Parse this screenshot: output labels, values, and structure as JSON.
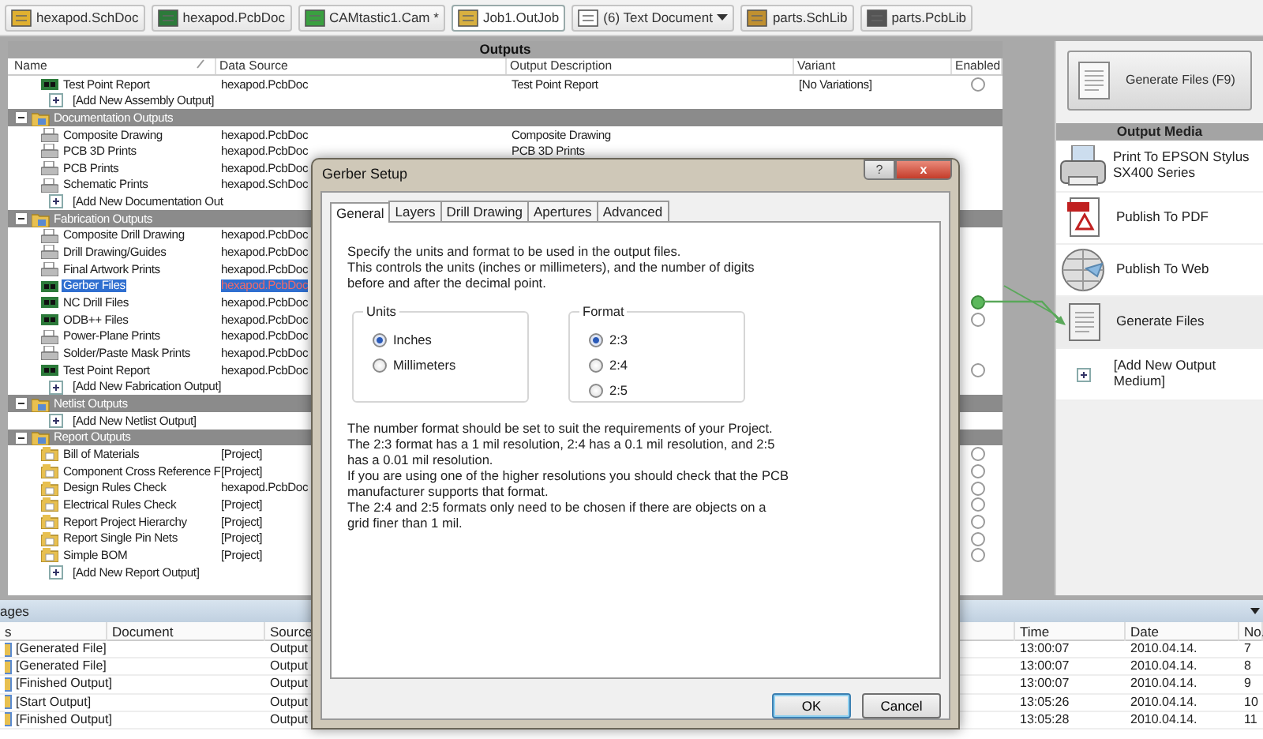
{
  "doc_tabs": [
    {
      "label": "hexapod.SchDoc",
      "kind": "schdoc",
      "selected": false
    },
    {
      "label": "hexapod.PcbDoc",
      "kind": "pcbdoc",
      "selected": false
    },
    {
      "label": "CAMtastic1.Cam *",
      "kind": "cam",
      "selected": false
    },
    {
      "label": "Job1.OutJob",
      "kind": "outjob",
      "selected": true
    },
    {
      "label": "(6) Text Document",
      "kind": "text",
      "selected": false,
      "dropdown": true
    },
    {
      "label": "parts.SchLib",
      "kind": "schlib",
      "selected": false
    },
    {
      "label": "parts.PcbLib",
      "kind": "pcblib",
      "selected": false
    }
  ],
  "outputs": {
    "title": "Outputs",
    "columns": [
      "Name",
      "Data Source",
      "Output Description",
      "Variant",
      "Enabled"
    ],
    "rows": [
      {
        "kind": "pcb",
        "name": "Test Point Report",
        "source": "hexapod.PcbDoc",
        "description": "Test Point Report",
        "variant": "[No Variations]",
        "enabled": false,
        "selected": false
      },
      {
        "kind": "add",
        "name": "[Add New Assembly Output]",
        "selected": false
      },
      {
        "kind": "group",
        "name": "Documentation Outputs",
        "expanded": true,
        "children": [
          {
            "kind": "print",
            "name": "Composite Drawing",
            "source": "hexapod.PcbDoc",
            "description": "Composite Drawing",
            "selected": false
          },
          {
            "kind": "print",
            "name": "PCB 3D Prints",
            "source": "hexapod.PcbDoc",
            "description": "PCB 3D Prints",
            "selected": false
          },
          {
            "kind": "print",
            "name": "PCB Prints",
            "source": "hexapod.PcbDoc",
            "selected": false
          },
          {
            "kind": "print",
            "name": "Schematic Prints",
            "source": "hexapod.SchDoc",
            "selected": false
          },
          {
            "kind": "add",
            "name": "[Add New Documentation Out",
            "selected": false
          }
        ]
      },
      {
        "kind": "group",
        "name": "Fabrication Outputs",
        "expanded": true,
        "children": [
          {
            "kind": "print",
            "name": "Composite Drill Drawing",
            "source": "hexapod.PcbDoc",
            "selected": false
          },
          {
            "kind": "print",
            "name": "Drill Drawing/Guides",
            "source": "hexapod.PcbDoc",
            "selected": false
          },
          {
            "kind": "print",
            "name": "Final Artwork Prints",
            "source": "hexapod.PcbDoc",
            "selected": false
          },
          {
            "kind": "pcb",
            "name": "Gerber Files",
            "source": "hexapod.PcbDoc",
            "selected": true
          },
          {
            "kind": "pcb",
            "name": "NC Drill Files",
            "source": "hexapod.PcbDoc",
            "enabled": true,
            "selected": false
          },
          {
            "kind": "pcb",
            "name": "ODB++ Files",
            "source": "hexapod.PcbDoc",
            "enabled": false,
            "selected": false
          },
          {
            "kind": "print",
            "name": "Power-Plane Prints",
            "source": "hexapod.PcbDoc",
            "selected": false
          },
          {
            "kind": "print",
            "name": "Solder/Paste Mask Prints",
            "source": "hexapod.PcbDoc",
            "selected": false
          },
          {
            "kind": "pcb",
            "name": "Test Point Report",
            "source": "hexapod.PcbDoc",
            "enabled": false,
            "selected": false
          },
          {
            "kind": "add",
            "name": "[Add New Fabrication Output]",
            "selected": false
          }
        ]
      },
      {
        "kind": "group",
        "name": "Netlist Outputs",
        "expanded": true,
        "children": [
          {
            "kind": "add",
            "name": "[Add New Netlist Output]",
            "selected": false
          }
        ]
      },
      {
        "kind": "group",
        "name": "Report Outputs",
        "expanded": true,
        "children": [
          {
            "kind": "report",
            "name": "Bill of Materials",
            "source": "[Project]",
            "enabled": false,
            "selected": false
          },
          {
            "kind": "report",
            "name": "Component Cross Reference F",
            "source": "[Project]",
            "enabled": false,
            "selected": false
          },
          {
            "kind": "report",
            "name": "Design Rules Check",
            "source": "hexapod.PcbDoc",
            "enabled": false,
            "selected": false
          },
          {
            "kind": "report",
            "name": "Electrical Rules Check",
            "source": "[Project]",
            "enabled": false,
            "selected": false
          },
          {
            "kind": "report",
            "name": "Report Project Hierarchy",
            "source": "[Project]",
            "enabled": false,
            "selected": false
          },
          {
            "kind": "report",
            "name": "Report Single Pin Nets",
            "source": "[Project]",
            "enabled": false,
            "selected": false
          },
          {
            "kind": "report",
            "name": "Simple BOM",
            "source": "[Project]",
            "enabled": false,
            "selected": false
          },
          {
            "kind": "add",
            "name": "[Add New Report Output]",
            "selected": false
          }
        ]
      }
    ]
  },
  "output_media": {
    "generate_button": "Generate Files (F9)",
    "title": "Output Media",
    "items": [
      {
        "kind": "printer",
        "label": "Print To EPSON Stylus SX400 Series",
        "selected": false
      },
      {
        "kind": "pdf",
        "label": "Publish To PDF",
        "selected": false
      },
      {
        "kind": "web",
        "label": "Publish To Web",
        "selected": false
      },
      {
        "kind": "files",
        "label": "Generate Files",
        "selected": true
      },
      {
        "kind": "add",
        "label": "[Add New Output Medium]",
        "selected": false
      }
    ]
  },
  "messages": {
    "title": "ages",
    "columns": [
      "s",
      "Document",
      "Source",
      "Time",
      "Date",
      "No."
    ],
    "rows": [
      {
        "class": "[Generated File]",
        "source": "Output",
        "time": "13:00:07",
        "date": "2010.04.14.",
        "no": "7"
      },
      {
        "class": "[Generated File]",
        "source": "Output",
        "time": "13:00:07",
        "date": "2010.04.14.",
        "no": "8"
      },
      {
        "class": "[Finished Output]",
        "source": "Output",
        "time": "13:00:07",
        "date": "2010.04.14.",
        "no": "9"
      },
      {
        "class": "[Start Output]",
        "source": "Output",
        "time": "13:05:26",
        "date": "2010.04.14.",
        "no": "10"
      },
      {
        "class": "[Finished Output]",
        "source": "Output",
        "time": "13:05:28",
        "date": "2010.04.14.",
        "no": "11"
      }
    ]
  },
  "dialog": {
    "title": "Gerber Setup",
    "help_button": "?",
    "close_button": "x",
    "tabs": [
      {
        "label": "General",
        "selected": true
      },
      {
        "label": "Layers",
        "selected": false
      },
      {
        "label": "Drill Drawing",
        "selected": false
      },
      {
        "label": "Apertures",
        "selected": false
      },
      {
        "label": "Advanced",
        "selected": false
      }
    ],
    "intro": [
      "Specify the units and format to be used in the output files.",
      "This controls the units (inches or millimeters), and the number of digits before and after the decimal point."
    ],
    "groups": [
      {
        "title": "Units",
        "options": [
          {
            "label": "Inches",
            "selected": true
          },
          {
            "label": "Millimeters",
            "selected": false
          }
        ]
      },
      {
        "title": "Format",
        "options": [
          {
            "label": "2:3",
            "selected": true
          },
          {
            "label": "2:4",
            "selected": false
          },
          {
            "label": "2:5",
            "selected": false
          }
        ]
      }
    ],
    "notes": [
      "The number format should be set to suit the requirements of your Project.",
      "The 2:3 format has a 1 mil resolution, 2:4 has a 0.1 mil resolution, and 2:5 has a 0.01 mil resolution.",
      "If you are using one of the higher resolutions you should check that the PCB manufacturer supports that format.",
      "The 2:4 and 2:5 formats only need to be chosen if there are objects on a grid finer than 1 mil."
    ],
    "buttons": [
      {
        "label": "OK",
        "default": true
      },
      {
        "label": "Cancel",
        "default": false
      }
    ]
  }
}
